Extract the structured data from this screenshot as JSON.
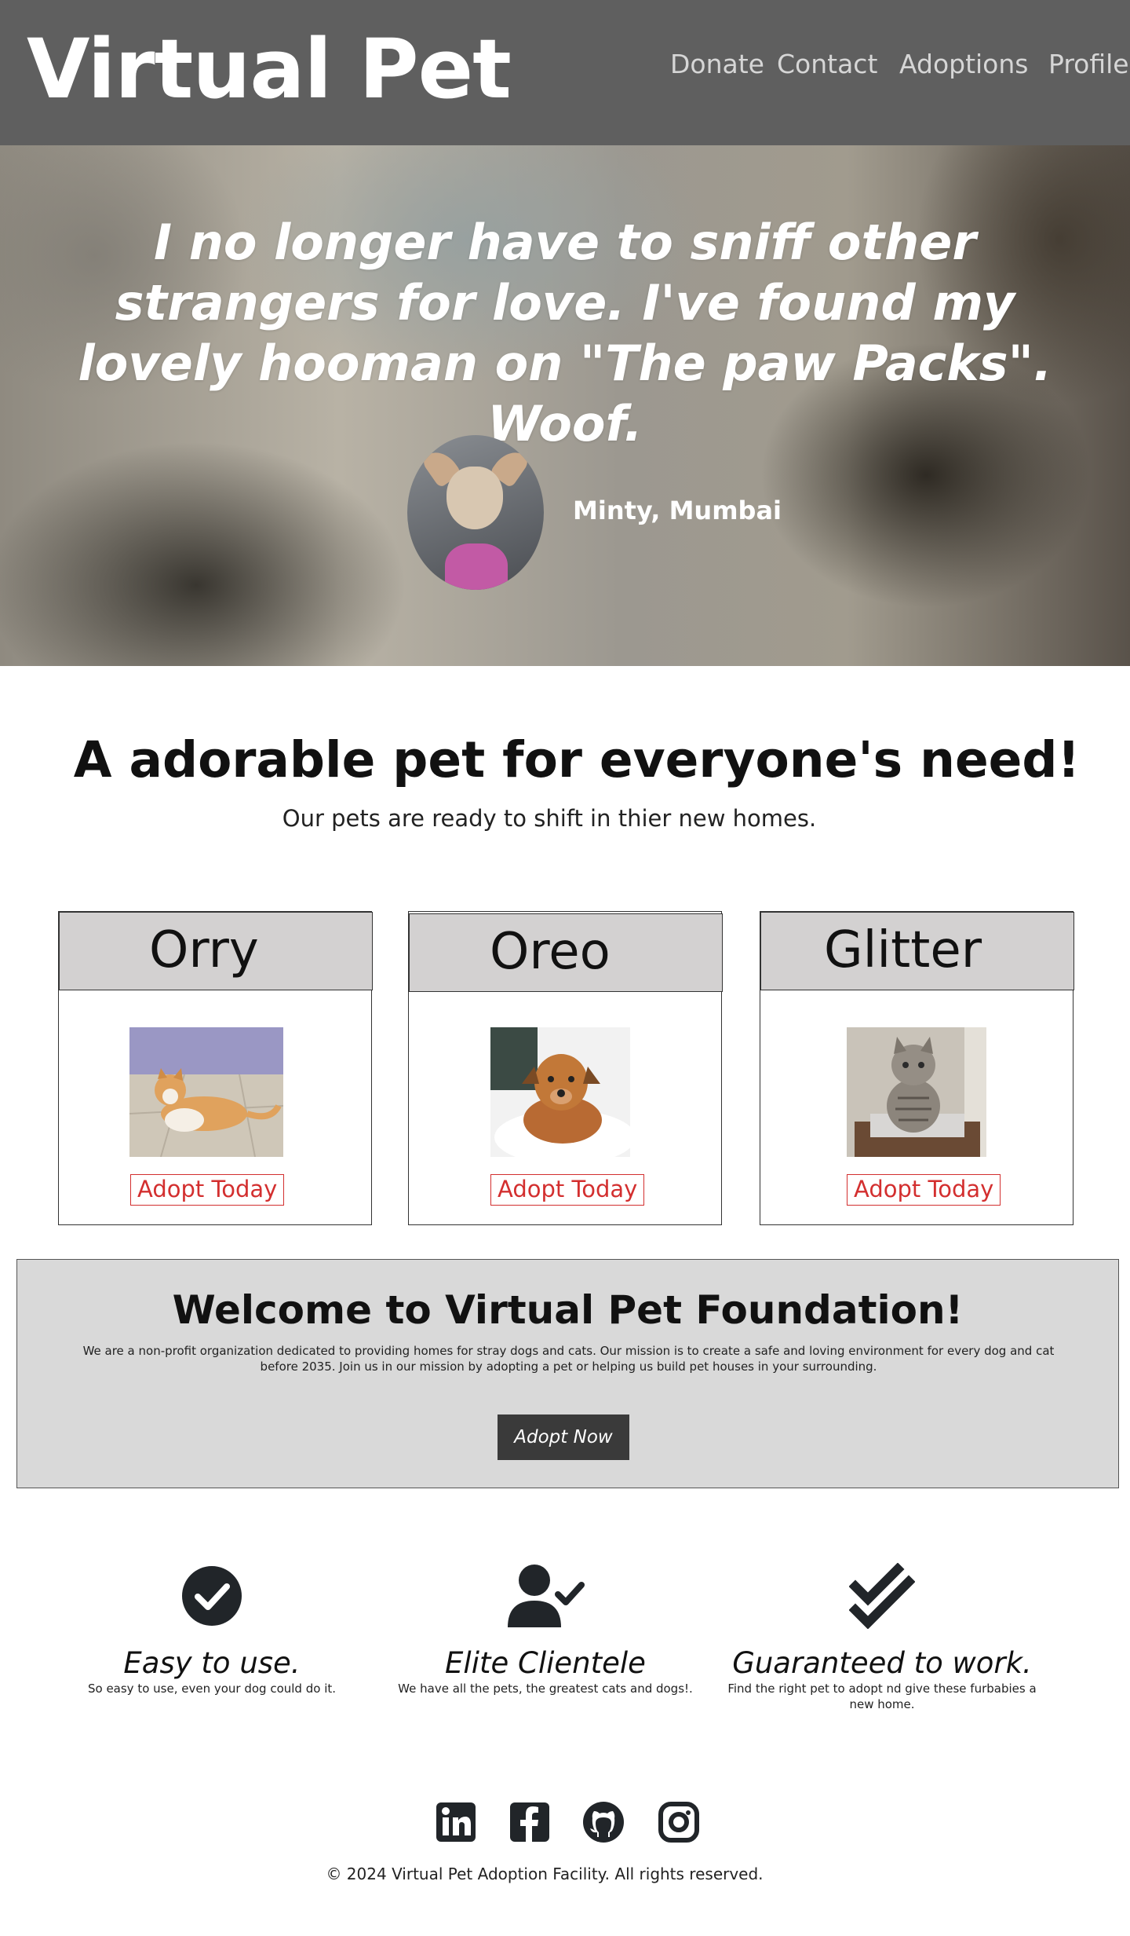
{
  "header": {
    "brand": "Virtual Pet",
    "nav": [
      "Donate",
      "Contact",
      "Adoptions",
      "Profile"
    ]
  },
  "hero": {
    "quote": "I no longer have to sniff other strangers for love. I've found my lovely hooman on \"The paw Packs\". Woof.",
    "author": "Minty, Mumbai"
  },
  "intro": {
    "title": "A adorable pet for everyone's need!",
    "subtitle": "Our pets are ready to shift in thier new homes."
  },
  "pets": [
    {
      "name": "Orry",
      "button": "Adopt Today"
    },
    {
      "name": "Oreo",
      "button": "Adopt Today"
    },
    {
      "name": "Glitter",
      "button": "Adopt Today"
    }
  ],
  "welcome": {
    "title": "Welcome to Virtual Pet Foundation!",
    "text": "We are a non-profit organization dedicated to providing homes for stray dogs and cats. Our mission is to create a safe and loving environment for every dog and cat before 2035. Join us in our mission by adopting a pet or helping us build pet houses in your surrounding.",
    "button": "Adopt Now"
  },
  "features": [
    {
      "icon": "check-circle-icon",
      "title": "Easy to use.",
      "desc": "So easy to use, even your dog could do it."
    },
    {
      "icon": "user-check-icon",
      "title": "Elite Clientele",
      "desc": "We have all the pets, the greatest cats and dogs!."
    },
    {
      "icon": "double-check-icon",
      "title": "Guaranteed to work.",
      "desc": "Find the right pet to adopt nd give these furbabies a new home."
    }
  ],
  "footer": {
    "social": [
      "linkedin-icon",
      "facebook-icon",
      "github-icon",
      "instagram-icon"
    ],
    "copyright": "© 2024 Virtual Pet Adoption Facility. All rights reserved."
  },
  "colors": {
    "header_bg": "#5f5f5f",
    "card_header_bg": "#d3d1d1",
    "adopt_button": "#d32f2f",
    "welcome_bg": "#d9d9d9",
    "dark_button": "#3a3a3a"
  }
}
